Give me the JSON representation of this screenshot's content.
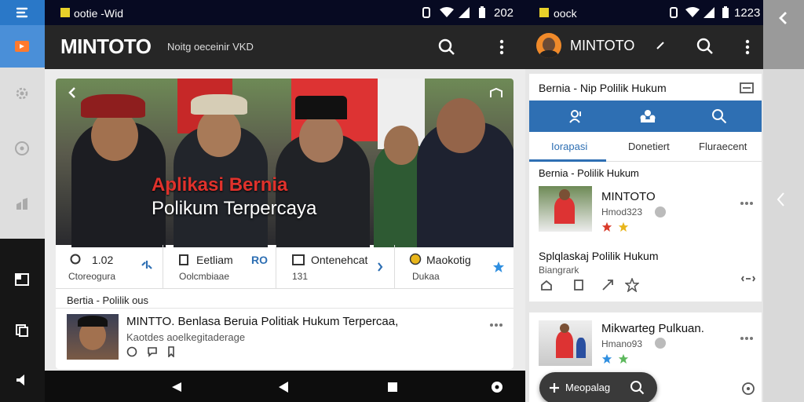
{
  "rail": {
    "icons": [
      "app-icon",
      "home-icon",
      "settings-icon",
      "clock-icon",
      "chart-icon",
      "dashboard-icon",
      "copy-icon",
      "speaker-icon"
    ]
  },
  "phone1": {
    "status": {
      "carrier": "ootie -Wid",
      "time": "202"
    },
    "appbar": {
      "title": "MINTOTO",
      "subtitle": "Noitg oeceinir VKD"
    },
    "hero": {
      "line1": "Aplikasi Bernia",
      "line2": "Polikum Terpercaya"
    },
    "stats": [
      {
        "title": "1.02",
        "sub": "Ctoreogura"
      },
      {
        "title": "Eetliam",
        "sub": "Oolcmbiaae",
        "extra": "RO"
      },
      {
        "title": "Ontenehcat",
        "sub": "131"
      },
      {
        "title": "Maokotig",
        "sub": "Dukaa"
      }
    ],
    "list_header": "Bertia - Polilik ous",
    "post": {
      "title": "MINTTO. Benlasa Beruia Politiak Hukum Terpercaa,",
      "sub": "Kaotdes aoelkegitaderage"
    }
  },
  "phone2": {
    "status": {
      "carrier": "oock",
      "time": "1223"
    },
    "appbar": {
      "title": "MINTOTO"
    },
    "card_header": "Bernia - Nip Polilik Hukum",
    "tabs": [
      "Iorapasi",
      "Donetiert",
      "Fluraecent"
    ],
    "section_title": "Bernia - Polilik Hukum",
    "item1": {
      "title": "MINTOTO",
      "sub": "Hmod323"
    },
    "item2": {
      "title": "Splqlaskaj Polilik Hukum",
      "sub": "Biangrark"
    },
    "item3": {
      "title": "Mikwarteg Pulkuan.",
      "sub": "Hmano93"
    },
    "fab_label": "Meopalag"
  },
  "colors": {
    "accent": "#2e6fb3",
    "status_bar": "#070a22",
    "app_bar": "#262626",
    "star_red": "#d93a2a",
    "star_yellow": "#e8b51a",
    "star_blue": "#2f8fe0",
    "star_green": "#5cb85c"
  }
}
